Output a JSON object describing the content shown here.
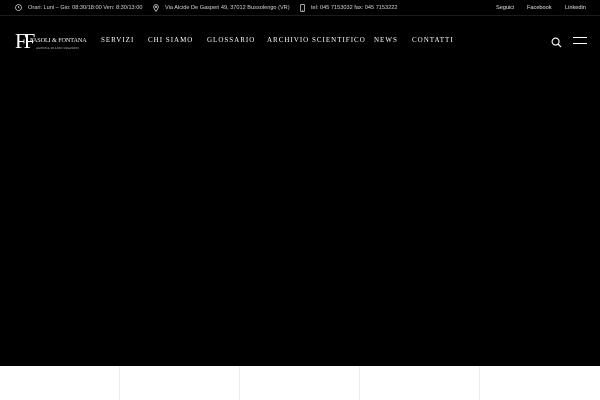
{
  "topbar": {
    "hours": "Orari: Luni – Gio: 08:30/18:00 Ven: 8:30/13:00",
    "address": "Via Alcide De Gasperi 49, 37012 Bussolengo (VR)",
    "phone": "tel: 045 7153032 fax: 045 7153222",
    "social_label": "Seguici",
    "links": [
      "Facebook",
      "Linkedin"
    ]
  },
  "logo": {
    "mark": "FF",
    "name": "FASOLI & FONTANA",
    "subtitle": "AGENZIA DI ASSICURAZIONI"
  },
  "nav": {
    "items": [
      "SERVIZI",
      "CHI SIAMO",
      "GLOSSARIO",
      "ARCHIVIO SCIENTIFICO",
      "NEWS",
      "CONTATTI"
    ]
  },
  "icons": {
    "hours": "clock-icon",
    "address": "map-pin-icon",
    "phone": "phone-icon",
    "search": "search-icon",
    "menu": "hamburger-menu-icon"
  },
  "colors": {
    "background": "#000000",
    "text": "#ffffff",
    "card_background": "#ffffff"
  }
}
